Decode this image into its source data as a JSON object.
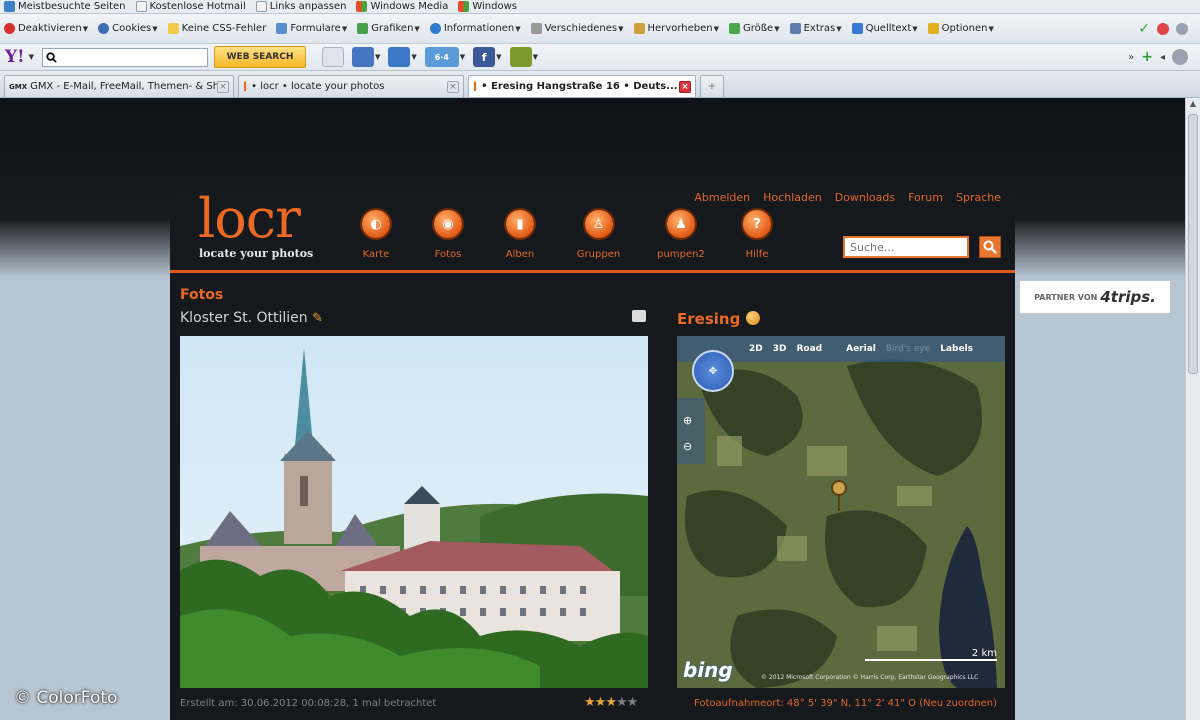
{
  "bookmarks": [
    {
      "label": "Meistbesuchte Seiten",
      "color": "#3f7fc8"
    },
    {
      "label": "Kostenlose Hotmail",
      "color": "#f2f2f2"
    },
    {
      "label": "Links anpassen",
      "color": "#f2f2f2"
    },
    {
      "label": "Windows Media",
      "color": "#e2a21e"
    },
    {
      "label": "Windows",
      "color": "#e2a21e"
    }
  ],
  "webdev_toolbar": [
    {
      "label": "Deaktivieren",
      "color": "#d83030"
    },
    {
      "label": "Cookies",
      "color": "#3d6fb4"
    },
    {
      "label": "Keine CSS-Fehler",
      "color": "#f2cb4a"
    },
    {
      "label": "Formulare",
      "color": "#5d8fd0"
    },
    {
      "label": "Grafiken",
      "color": "#4aa04a"
    },
    {
      "label": "Informationen",
      "color": "#2b7bd0"
    },
    {
      "label": "Verschiedenes",
      "color": "#8a8a8a"
    },
    {
      "label": "Hervorheben",
      "color": "#d2a03a"
    },
    {
      "label": "Größe",
      "color": "#4aa84a"
    },
    {
      "label": "Extras",
      "color": "#5e7fae"
    },
    {
      "label": "Quelltext",
      "color": "#3a7ad0"
    },
    {
      "label": "Optionen",
      "color": "#e0b020"
    }
  ],
  "yahoo_toolbar": {
    "logo": "Y!",
    "search_value": "",
    "button": "WEB SEARCH",
    "badge": "6·4"
  },
  "tabs": [
    {
      "label": "GMX - E-Mail, FreeMail, Themen- & Sho...",
      "active": false,
      "prefix": "GMX"
    },
    {
      "label": "• locr • locate your photos",
      "active": false,
      "prefix": "l"
    },
    {
      "label": "• Eresing Hangstraße 16 • Deuts...",
      "active": true,
      "prefix": "l"
    }
  ],
  "site": {
    "logo": "locr",
    "tagline": "locate your photos",
    "top_links": [
      "Abmelden",
      "Hochladen",
      "Downloads",
      "Forum",
      "Sprache"
    ],
    "nav": [
      "Karte",
      "Fotos",
      "Alben",
      "Gruppen",
      "pumpen2",
      "Hilfe"
    ],
    "search_placeholder": "Suche...",
    "section_title": "Fotos",
    "photo_title": "Kloster St. Ottilien",
    "map_title": "Eresing",
    "map_modes": [
      "2D",
      "3D",
      "Road",
      "Aerial",
      "Bird's eye",
      "Labels"
    ],
    "map_brand": "bing",
    "map_scale": "2 km",
    "map_copyright": "© 2012 Microsoft Corporation   © Harris Corp, Earthstar Geographics LLC",
    "photo_meta": "Erstellt am: 30.06.2012 00:08:28, 1 mal betrachtet",
    "rating": {
      "value": 3,
      "max": 5
    },
    "map_meta": "Fotoaufnahmeort: 48° 5' 39\" N, 11° 2' 41\" O (Neu zuordnen)"
  },
  "partner": {
    "prefix": "PARTNER VON",
    "brand": "4trips."
  },
  "watermark": "© ColorFoto",
  "colors": {
    "accent": "#ea6a24",
    "site_bg": "#15181c",
    "page_bg": "#b8c6d1"
  }
}
